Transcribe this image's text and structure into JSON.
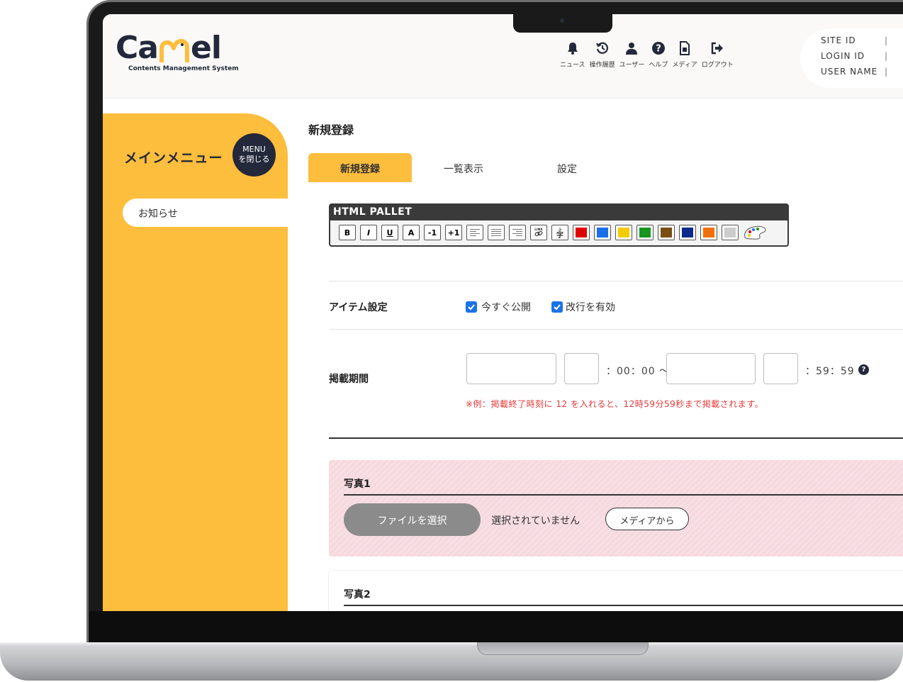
{
  "logo": {
    "name": "Camel",
    "subtitle": "Contents Management System"
  },
  "header": {
    "nav": [
      {
        "icon": "bell-icon",
        "label": "ニュース"
      },
      {
        "icon": "history-icon",
        "label": "操作履歴"
      },
      {
        "icon": "user-icon",
        "label": "ユーザー"
      },
      {
        "icon": "help-icon",
        "label": "ヘルプ"
      },
      {
        "icon": "media-file-icon",
        "label": "メディア"
      },
      {
        "icon": "logout-icon",
        "label": "ログアウト"
      }
    ],
    "site_info": [
      {
        "label": "SITE ID",
        "sep": "|"
      },
      {
        "label": "LOGIN ID",
        "sep": "|"
      },
      {
        "label": "USER NAME",
        "sep": "|"
      }
    ]
  },
  "sidebar": {
    "title": "メインメニュー",
    "close_line1": "MENU",
    "close_line2": "を閉じる",
    "items": [
      {
        "label": "お知らせ"
      }
    ]
  },
  "main": {
    "page_title": "新規登録",
    "tabs": [
      {
        "label": "新規登録",
        "active": true
      },
      {
        "label": "一覧表示",
        "active": false
      },
      {
        "label": "設定",
        "active": false
      }
    ],
    "pallet": {
      "title": "HTML PALLET",
      "text_buttons": [
        "B",
        "I",
        "U",
        "A",
        "-1",
        "+1"
      ],
      "icon_buttons": [
        "align-left-icon",
        "align-center-icon",
        "align-right-icon",
        "link-icon",
        "ruby-icon"
      ],
      "colors": [
        "#e00000",
        "#1a6fe8",
        "#f5cc00",
        "#17951f",
        "#7a4c16",
        "#0b2a8a",
        "#f2700c",
        "#cccccc"
      ],
      "palette_icon": "color-palette-icon"
    },
    "item_settings": {
      "label": "アイテム設定",
      "options": [
        {
          "label": "今すぐ公開",
          "checked": true
        },
        {
          "label": "改行を有効",
          "checked": true
        }
      ]
    },
    "period": {
      "label": "掲載期間",
      "start_time_suffix": "：00：00 〜",
      "end_time_suffix": "：59：59",
      "note": "※例：掲載終了時刻に 12 を入れると、12時59分59秒まで掲載されます。"
    },
    "photos": [
      {
        "title": "写真1",
        "button": "ファイルを選択",
        "status": "選択されていません",
        "media_button": "メディアから"
      },
      {
        "title": "写真2"
      }
    ]
  }
}
